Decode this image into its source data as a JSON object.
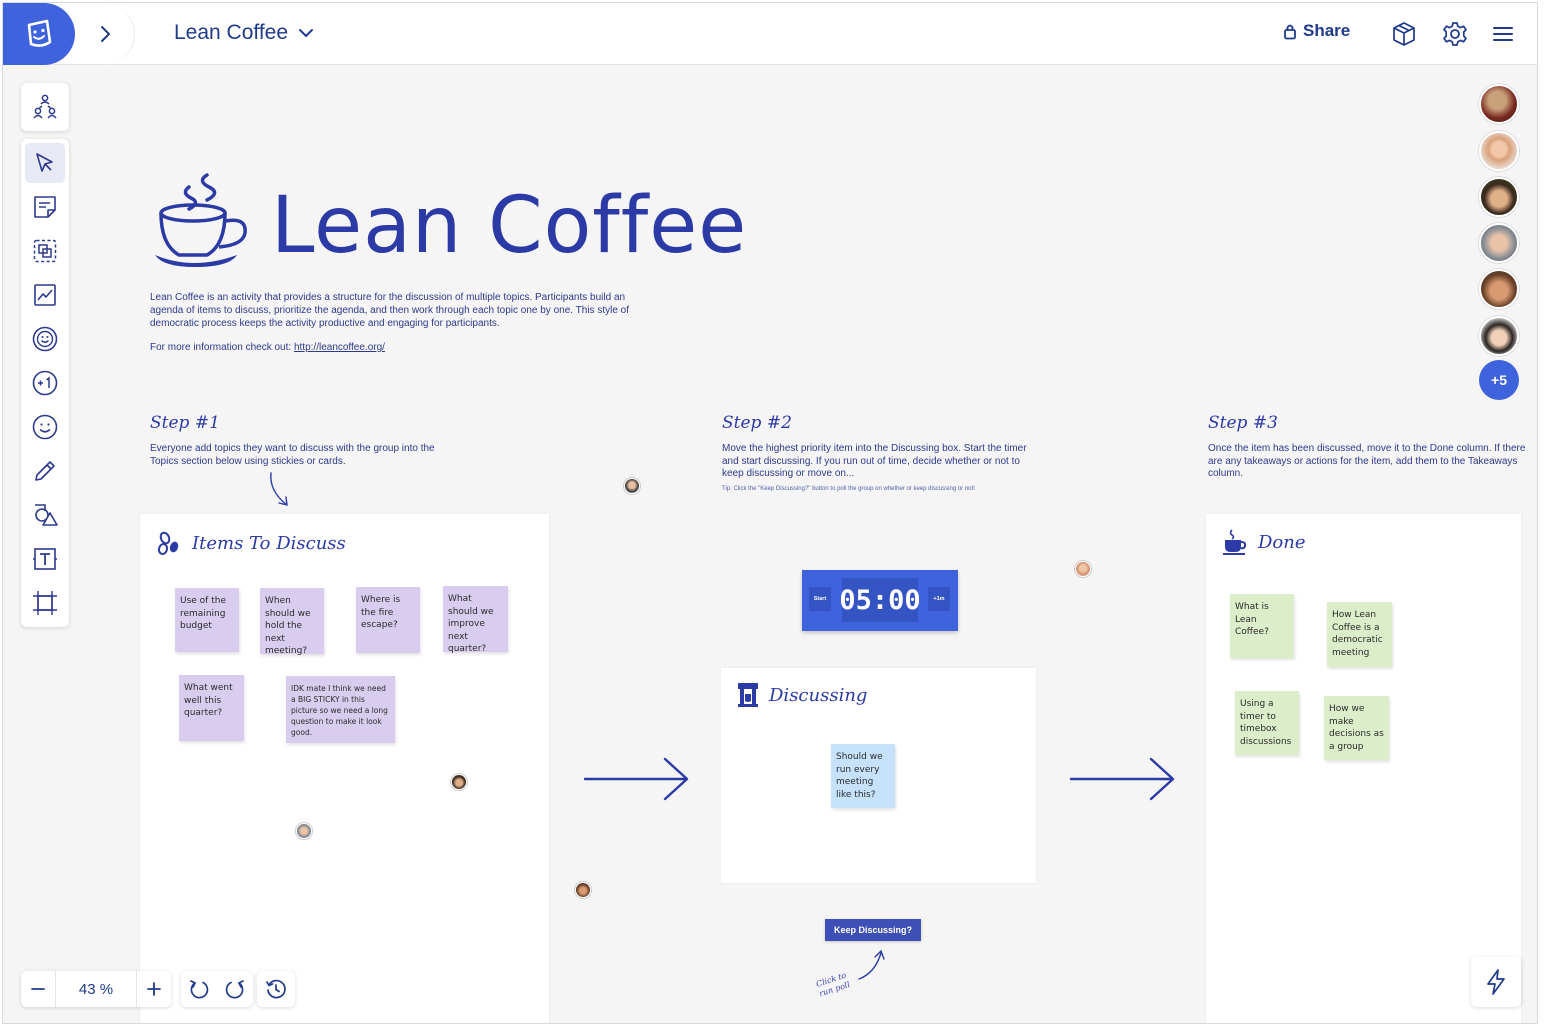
{
  "topbar": {
    "board_title": "Lean Coffee",
    "share_label": "Share"
  },
  "toolbar": {
    "items": [
      "collaborate",
      "select",
      "sticky-note",
      "frame-group",
      "image",
      "sticker",
      "vote",
      "emoji",
      "pen",
      "shapes",
      "text",
      "frame"
    ]
  },
  "collaborators": {
    "more_count": "+5"
  },
  "board": {
    "hero_title": "Lean Coffee",
    "intro": "Lean Coffee is an activity that provides a structure for the discussion of multiple topics.  Participants build an agenda of items to discuss, prioritize the agenda, and then work through each topic one by one.  This style of democratic process keeps the activity productive and engaging for participants.",
    "more_info_prefix": "For more information check out: ",
    "more_info_link": "http://leancoffee.org/",
    "steps": [
      {
        "title": "Step #1",
        "text": "Everyone add topics they want to discuss with the group into the Topics section below using stickies or cards."
      },
      {
        "title": "Step #2",
        "text": "Move the highest priority item into the Discussing box.  Start the timer and start discussing.  If you run out of time, decide whether or not to keep discussing or move on..."
      },
      {
        "title": "Step #3",
        "text": "Once the item has been discussed, move it to the Done column.  If there are any takeaways or actions for the item, add them to the Takeaways column."
      }
    ],
    "tip": "Tip: Click the \"Keep Discussing?\" button to poll the group on whether or keep discussing or not!",
    "items_panel": {
      "title": "Items To Discuss",
      "stickies": [
        "Use of the remaining budget",
        "When should we hold the next meeting?",
        "Where is the fire escape?",
        "What should we improve next quarter?",
        "What went well this quarter?",
        "IDK mate I think we need a BIG STICKY in this picture so we need a long question to make it look good."
      ]
    },
    "timer": {
      "start_label": "Start",
      "display": "05:00",
      "add_label": "+1m"
    },
    "discussing_panel": {
      "title": "Discussing",
      "stickies": [
        "Should we run every meeting like this?"
      ]
    },
    "keep_button": "Keep Discussing?",
    "click_note": "Click to run poll",
    "done_panel": {
      "title": "Done",
      "stickies": [
        "What is Lean Coffee?",
        "How Lean Coffee is a democratic meeting",
        "Using a timer to timebox discussions",
        "How we make decisions as a group"
      ]
    }
  },
  "zoom": {
    "value": "43 %"
  },
  "colors": {
    "brand": "#3e63dd",
    "ink": "#2c3aa6",
    "sticky_purple": "#d8cdef",
    "sticky_green": "#dcedc9",
    "sticky_blue": "#c5e2fa"
  }
}
